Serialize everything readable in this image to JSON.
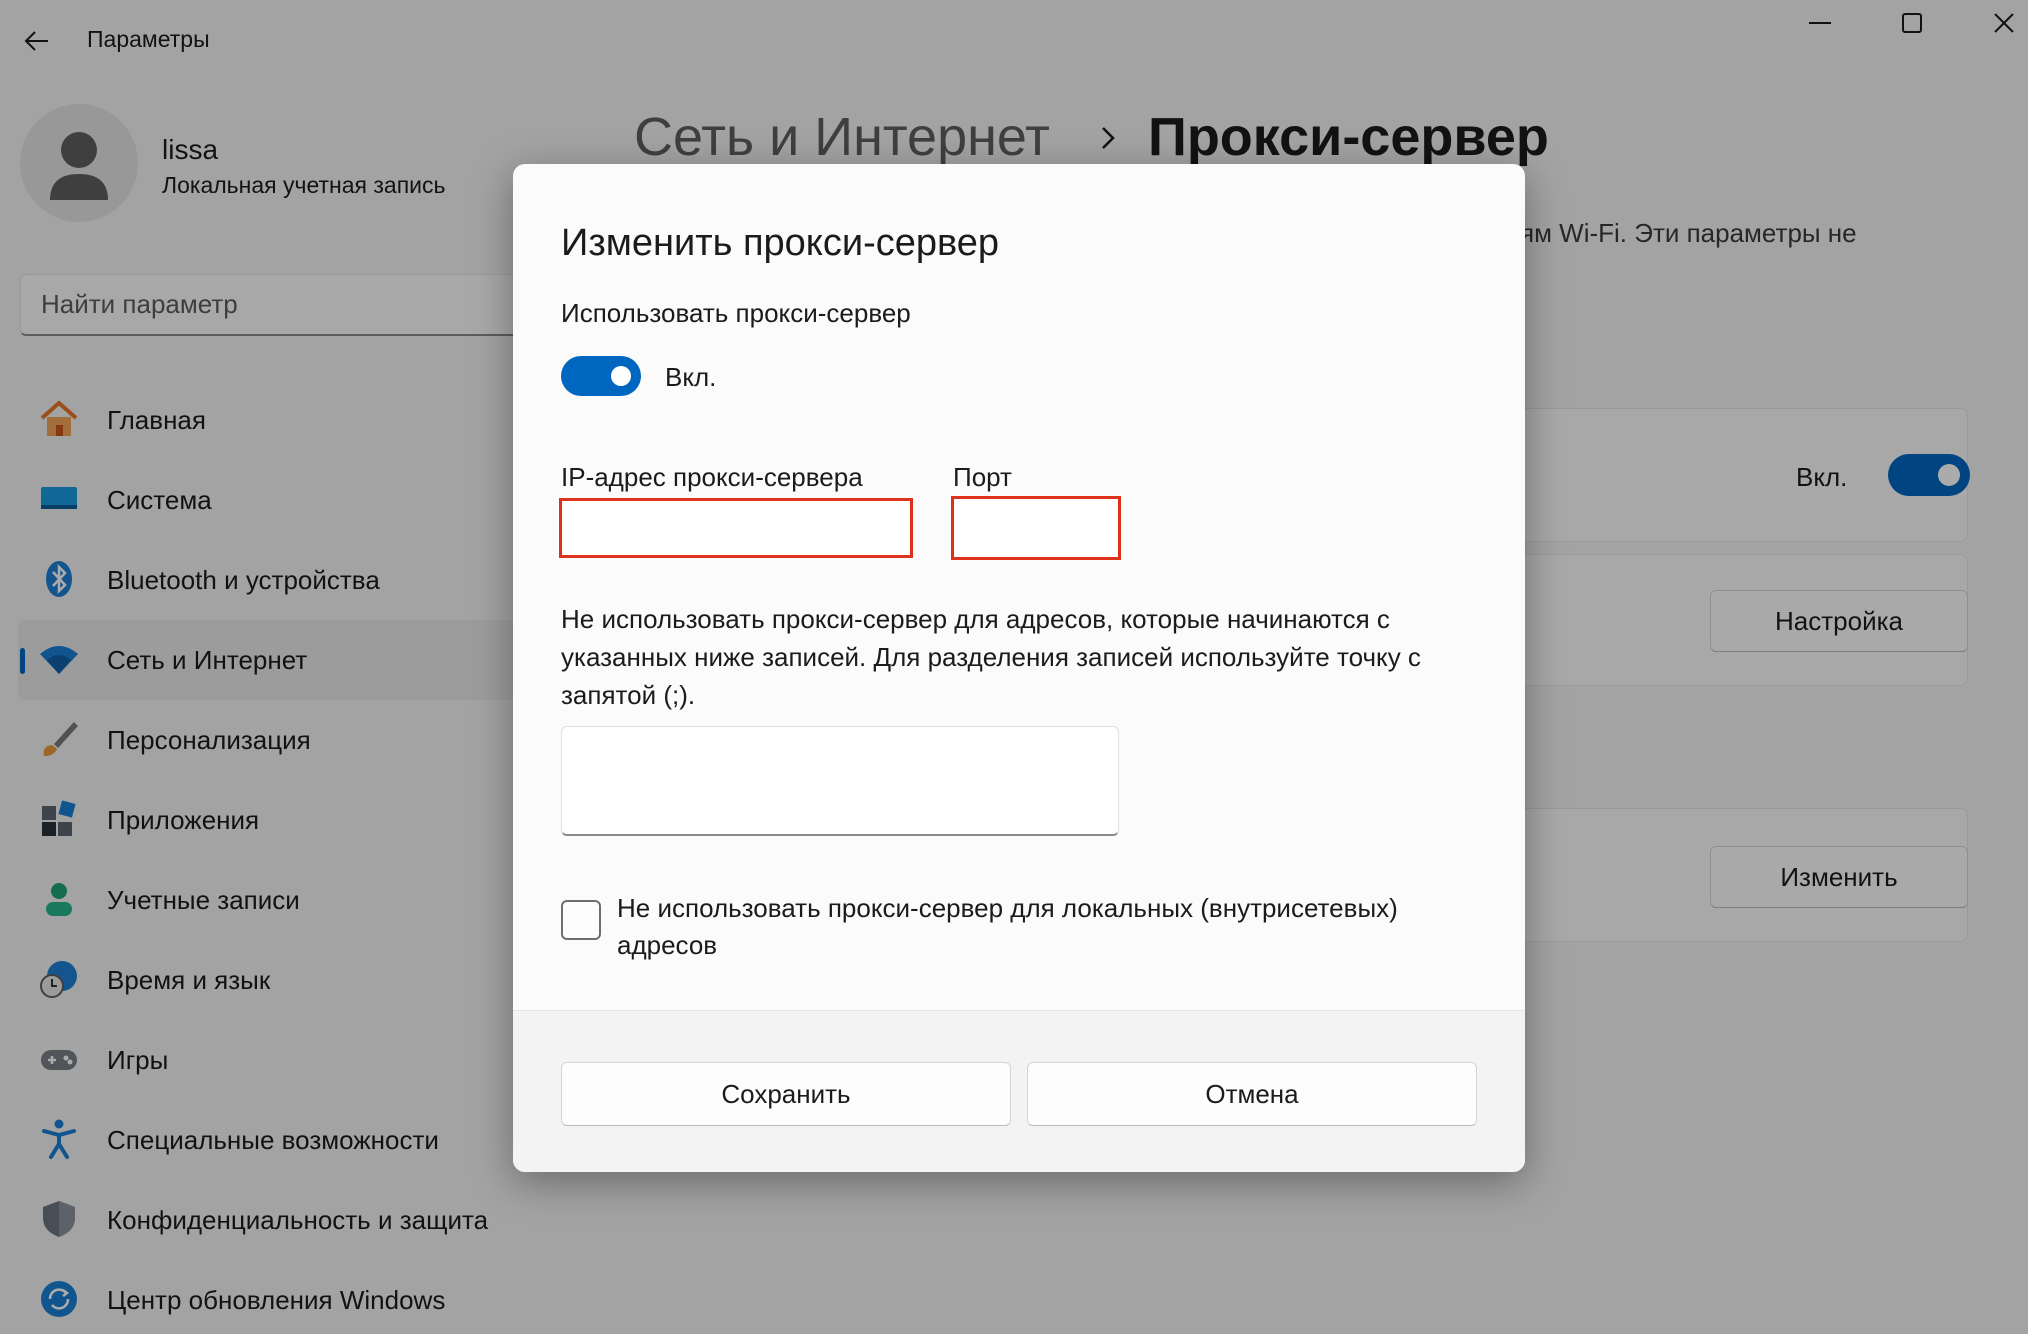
{
  "window": {
    "title": "Параметры"
  },
  "profile": {
    "name": "lissa",
    "account_type": "Локальная учетная запись"
  },
  "search": {
    "placeholder": "Найти параметр"
  },
  "sidebar": {
    "items": [
      {
        "label": "Главная",
        "icon": "home-icon",
        "active": false
      },
      {
        "label": "Система",
        "icon": "system-icon",
        "active": false
      },
      {
        "label": "Bluetooth и устройства",
        "icon": "bluetooth-icon",
        "active": false
      },
      {
        "label": "Сеть и Интернет",
        "icon": "wifi-icon",
        "active": true
      },
      {
        "label": "Персонализация",
        "icon": "brush-icon",
        "active": false
      },
      {
        "label": "Приложения",
        "icon": "apps-icon",
        "active": false
      },
      {
        "label": "Учетные записи",
        "icon": "account-icon",
        "active": false
      },
      {
        "label": "Время и язык",
        "icon": "time-language-icon",
        "active": false
      },
      {
        "label": "Игры",
        "icon": "gamepad-icon",
        "active": false
      },
      {
        "label": "Специальные возможности",
        "icon": "accessibility-icon",
        "active": false
      },
      {
        "label": "Конфиденциальность и защита",
        "icon": "shield-icon",
        "active": false
      },
      {
        "label": "Центр обновления Windows",
        "icon": "update-icon",
        "active": false
      }
    ]
  },
  "main": {
    "breadcrumb_parent": "Сеть и Интернет",
    "breadcrumb_current": "Прокси-сервер",
    "description_fragment": "ям Wi-Fi. Эти параметры не",
    "toggle_state": "Вкл.",
    "setup_button": "Настройка",
    "edit_button": "Изменить"
  },
  "dialog": {
    "title": "Изменить прокси-сервер",
    "use_proxy_label": "Использовать прокси-сервер",
    "toggle_state": "Вкл.",
    "ip_label": "IP-адрес прокси-сервера",
    "ip_value": "",
    "port_label": "Порт",
    "port_value": "",
    "exclusions_description": "Не использовать прокси-сервер для адресов, которые начинаются с указанных ниже записей. Для разделения записей используйте точку с запятой (;).",
    "exclusions_value": "",
    "local_checkbox_label": "Не использовать прокси-сервер для локальных (внутрисетевых) адресов",
    "save_button": "Сохранить",
    "cancel_button": "Отмена"
  },
  "colors": {
    "accent": "#0067c0",
    "highlight_border": "#e0311a"
  }
}
